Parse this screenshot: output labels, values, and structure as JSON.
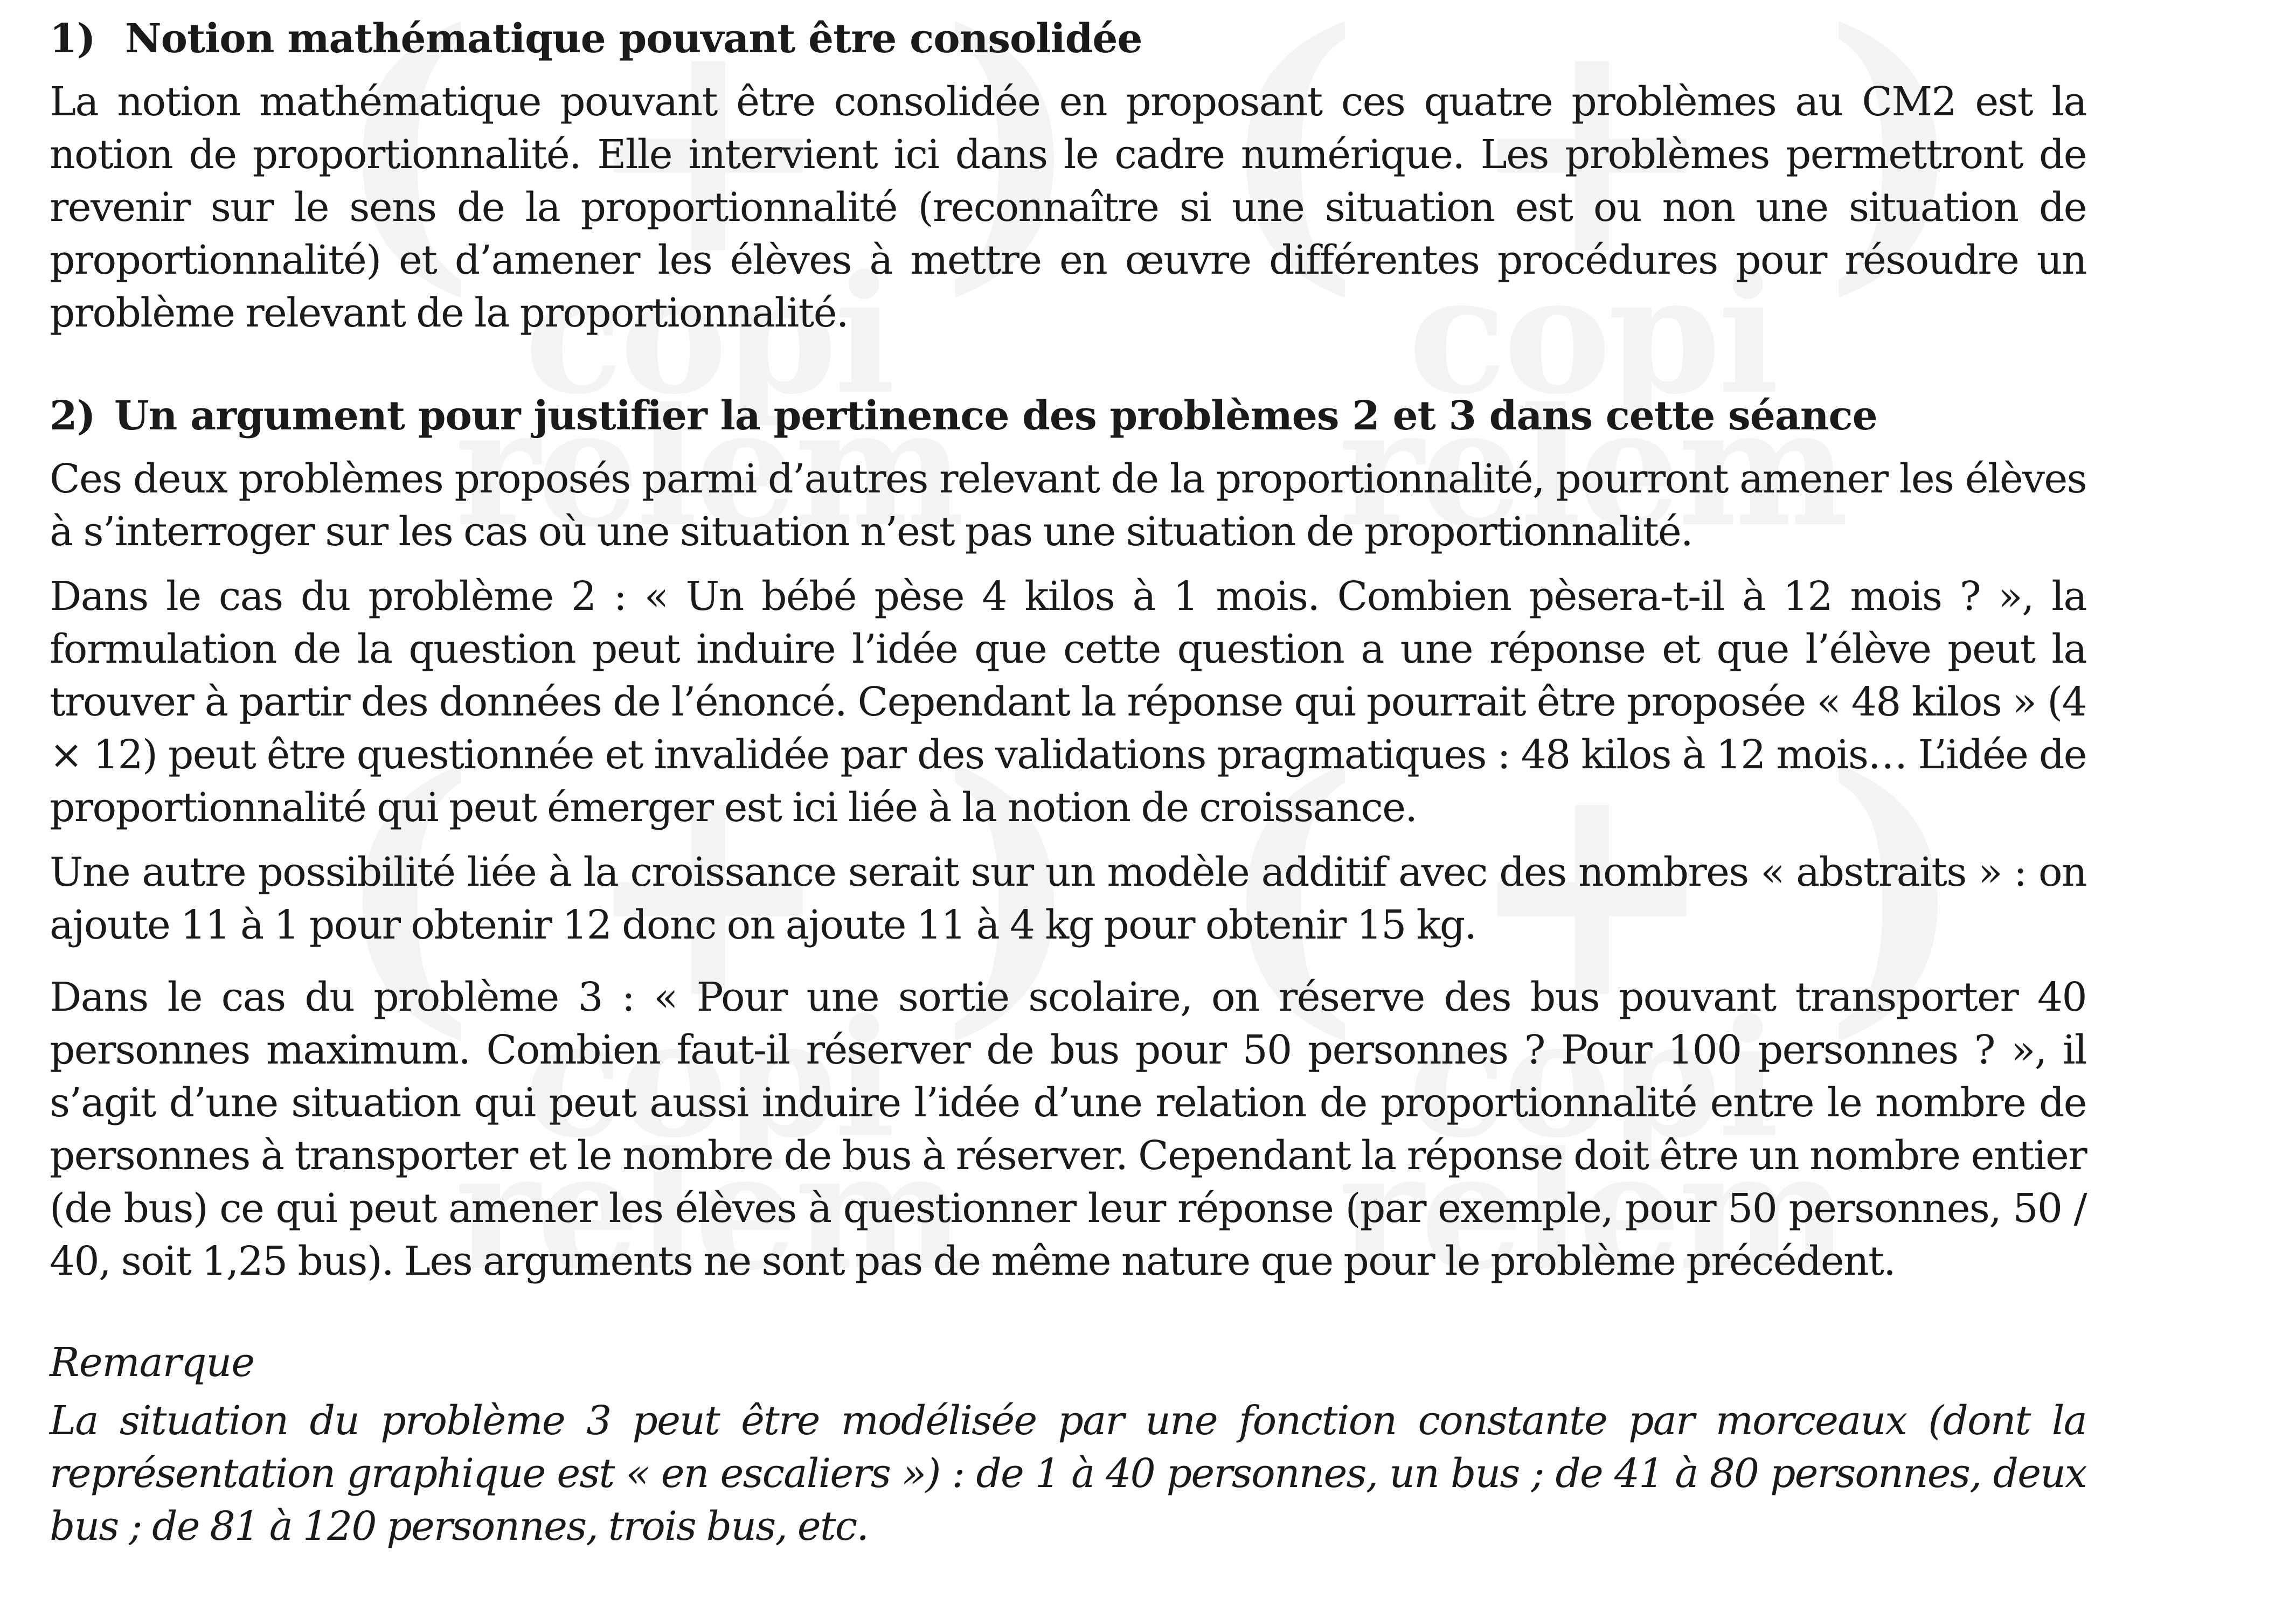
{
  "watermark": {
    "symbols": "( + )",
    "word1": "copi",
    "word2": "relem"
  },
  "section1": {
    "number": "1)",
    "title": "Notion mathématique pouvant être consolidée",
    "paragraphs": [
      "La notion mathématique pouvant être consolidée en proposant ces quatre problèmes au CM2 est la notion de proportionnalité. Elle intervient ici dans le cadre numérique. Les problèmes permettront de revenir sur le sens de la proportionnalité (reconnaître si une situation est ou non une situation de proportionnalité) et d’amener les élèves à mettre en œuvre différentes procédures pour résoudre un problème relevant de la proportionnalité."
    ]
  },
  "section2": {
    "number": "2)",
    "title": "Un argument pour justifier la pertinence des problèmes 2 et 3 dans cette séance",
    "paragraphs": [
      "Ces deux problèmes proposés parmi d’autres relevant de la proportionnalité, pourront amener les élèves à s’interroger sur les cas où une situation n’est pas une situation de proportionnalité.",
      "Dans le cas du problème 2 : « Un bébé pèse 4 kilos à 1 mois. Combien pèsera-t-il à 12 mois ? », la formulation de la question peut induire l’idée que cette question a une réponse et que l’élève peut la trouver à partir des données de l’énoncé. Cependant la réponse qui pourrait être proposée « 48 kilos » (4 × 12) peut être questionnée et invalidée par des validations pragmatiques : 48 kilos à 12 mois… L’idée de proportionnalité qui peut émerger est ici liée à la notion de croissance.",
      "Une autre possibilité liée à la croissance serait sur un modèle additif avec des nombres « abstraits » : on ajoute 11 à 1 pour obtenir 12 donc on ajoute 11 à 4 kg pour obtenir 15 kg.",
      "Dans le cas du problème 3 : « Pour une sortie scolaire, on réserve des bus pouvant transporter 40 personnes maximum. Combien faut-il réserver de bus pour 50 personnes ? Pour 100 personnes ? », il s’agit d’une situation qui peut aussi induire l’idée d’une relation de proportionnalité entre le nombre de personnes à transporter et le nombre de bus à réserver. Cependant la réponse doit être un nombre entier (de bus) ce qui peut amener les élèves à questionner leur réponse (par exemple, pour 50 personnes, 50 / 40, soit 1,25 bus). Les arguments ne sont pas de même nature que pour le problème précédent."
    ]
  },
  "remark": {
    "title": "Remarque",
    "text": "La situation du problème 3 peut être modélisée par une fonction constante par morceaux (dont la représentation graphique est « en escaliers ») : de 1 à 40 personnes, un bus ; de 41 à 80 personnes, deux bus ; de 81 à 120 personnes, trois bus, etc."
  }
}
